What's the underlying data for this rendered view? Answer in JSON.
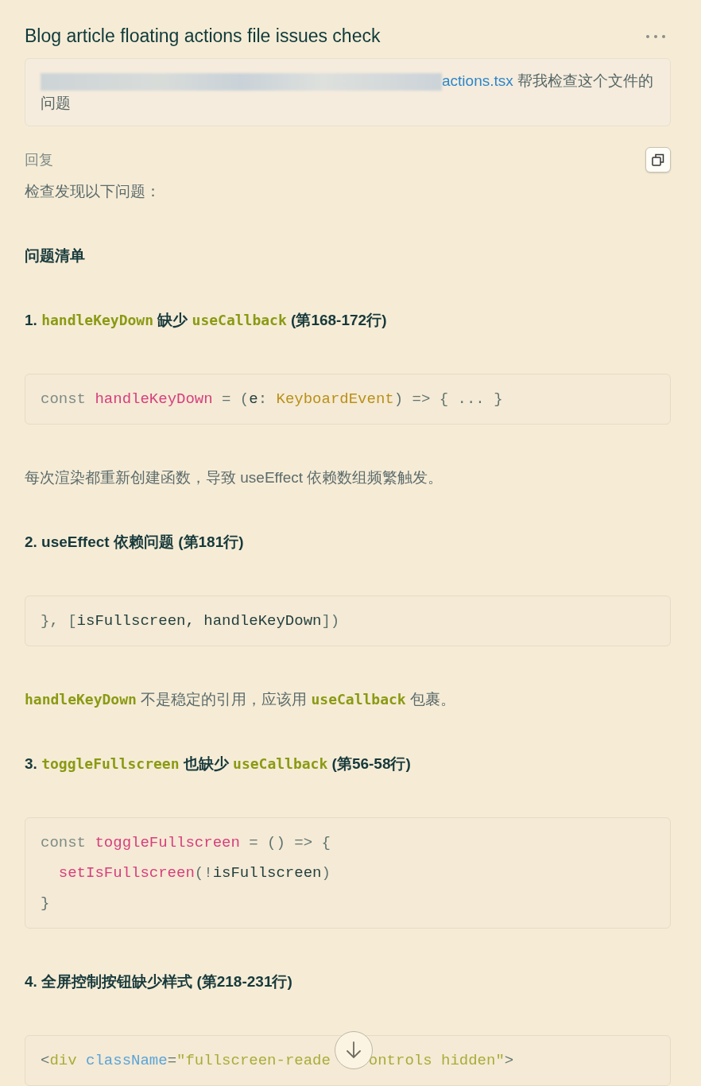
{
  "title": "Blog article floating actions file issues check",
  "prompt": {
    "link": "actions.tsx",
    "text": " 帮我检查这个文件的问题"
  },
  "reply_label": "回复",
  "blocks": [
    {
      "kind": "para",
      "segments": [
        {
          "kind": "text",
          "text": "检查发现以下问题："
        }
      ]
    },
    {
      "kind": "heading",
      "segments": [
        {
          "kind": "text",
          "text": "问题清单"
        }
      ]
    },
    {
      "kind": "heading",
      "segments": [
        {
          "kind": "text",
          "text": "1. "
        },
        {
          "kind": "code",
          "text": "handleKeyDown"
        },
        {
          "kind": "text",
          "text": " 缺少 "
        },
        {
          "kind": "code",
          "text": "useCallback"
        },
        {
          "kind": "text",
          "text": " (第168-172行)"
        }
      ]
    },
    {
      "kind": "code",
      "lines": [
        {
          "indented": false,
          "tokens": [
            {
              "kind": "kw",
              "text": "const "
            },
            {
              "kind": "fn",
              "text": "handleKeyDown"
            },
            {
              "kind": "p",
              "text": " = ("
            },
            {
              "kind": "id",
              "text": "e"
            },
            {
              "kind": "p",
              "text": ": "
            },
            {
              "kind": "type",
              "text": "KeyboardEvent"
            },
            {
              "kind": "p",
              "text": ") => { ... }"
            }
          ]
        }
      ]
    },
    {
      "kind": "para",
      "segments": [
        {
          "kind": "text",
          "text": "每次渲染都重新创建函数，导致 useEffect 依赖数组频繁触发。"
        }
      ]
    },
    {
      "kind": "heading",
      "segments": [
        {
          "kind": "text",
          "text": "2. useEffect 依赖问题 (第181行)"
        }
      ]
    },
    {
      "kind": "code",
      "lines": [
        {
          "indented": false,
          "tokens": [
            {
              "kind": "p",
              "text": "}, ["
            },
            {
              "kind": "id",
              "text": "isFullscreen, handleKeyDown"
            },
            {
              "kind": "p",
              "text": "])"
            }
          ]
        }
      ]
    },
    {
      "kind": "para",
      "segments": [
        {
          "kind": "code",
          "text": "handleKeyDown"
        },
        {
          "kind": "text",
          "text": " 不是稳定的引用，应该用 "
        },
        {
          "kind": "code",
          "text": "useCallback"
        },
        {
          "kind": "text",
          "text": " 包裹。"
        }
      ]
    },
    {
      "kind": "heading",
      "segments": [
        {
          "kind": "text",
          "text": "3. "
        },
        {
          "kind": "code",
          "text": "toggleFullscreen"
        },
        {
          "kind": "text",
          "text": " 也缺少 "
        },
        {
          "kind": "code",
          "text": "useCallback"
        },
        {
          "kind": "text",
          "text": " (第56-58行)"
        }
      ]
    },
    {
      "kind": "code",
      "lines": [
        {
          "indented": false,
          "tokens": [
            {
              "kind": "kw",
              "text": "const "
            },
            {
              "kind": "fn",
              "text": "toggleFullscreen"
            },
            {
              "kind": "p",
              "text": " = () => {"
            }
          ]
        },
        {
          "indented": true,
          "tokens": [
            {
              "kind": "fn",
              "text": "setIsFullscreen"
            },
            {
              "kind": "p",
              "text": "(!"
            },
            {
              "kind": "id",
              "text": "isFullscreen"
            },
            {
              "kind": "p",
              "text": ")"
            }
          ]
        },
        {
          "indented": false,
          "tokens": [
            {
              "kind": "p",
              "text": "}"
            }
          ]
        }
      ]
    },
    {
      "kind": "heading",
      "segments": [
        {
          "kind": "text",
          "text": "4. 全屏控制按钮缺少样式 (第218-231行)"
        }
      ]
    },
    {
      "kind": "code",
      "lines": [
        {
          "indented": false,
          "tokens": [
            {
              "kind": "p",
              "text": "<"
            },
            {
              "kind": "tag",
              "text": "div"
            },
            {
              "kind": "attr",
              "text": " className"
            },
            {
              "kind": "p",
              "text": "="
            },
            {
              "kind": "tag",
              "text": "\"fullscreen-reade"
            },
            {
              "kind": "gap"
            },
            {
              "kind": "tag",
              "text": "ontrols hidden\""
            },
            {
              "kind": "p",
              "text": ">"
            }
          ]
        }
      ]
    }
  ]
}
